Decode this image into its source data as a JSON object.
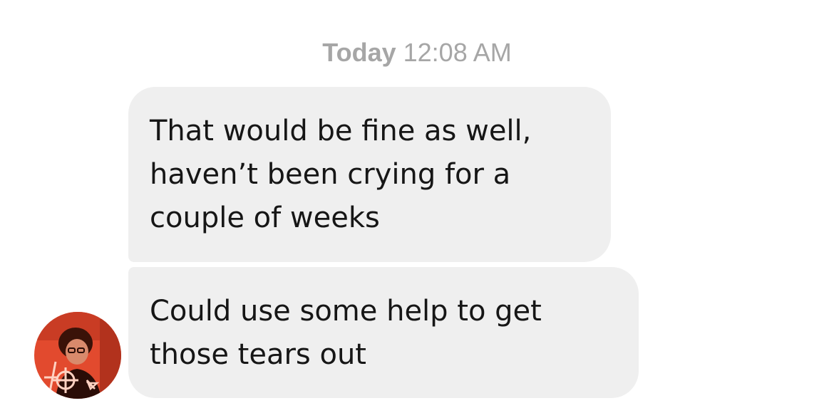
{
  "thread": {
    "timestamp_day": "Today",
    "timestamp_time": "12:08 AM"
  },
  "messages": [
    {
      "lines": [
        "That would be fine as well,",
        "haven’t been crying for a",
        "couple of weeks"
      ]
    },
    {
      "lines": [
        "Could use some help to get",
        "those tears out"
      ]
    }
  ],
  "colors": {
    "bubble_background": "#efefef",
    "timestamp_text": "#a6a6a6",
    "message_text": "#161616",
    "avatar_tint": "#e14a2d"
  },
  "icons": {
    "avatar": "sender-avatar-photo"
  }
}
